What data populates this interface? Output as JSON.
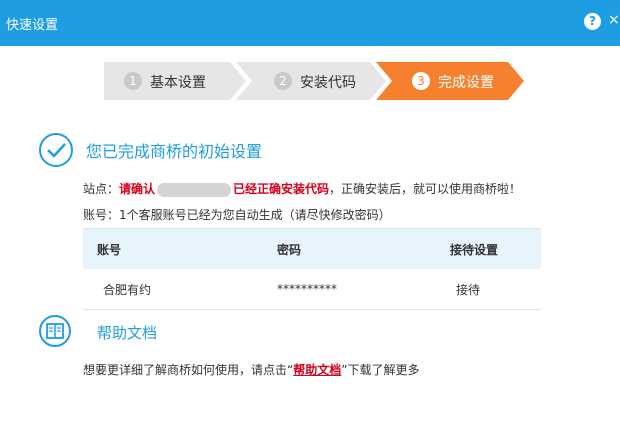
{
  "window": {
    "title": "快速设置",
    "help_symbol": "?",
    "close_symbol": "×"
  },
  "steps": [
    {
      "num": "1",
      "label": "基本设置",
      "state": "done"
    },
    {
      "num": "2",
      "label": "安装代码",
      "state": "done"
    },
    {
      "num": "3",
      "label": "完成设置",
      "state": "active"
    }
  ],
  "colors": {
    "accent": "#1e9de3",
    "active_step": "#f5812e",
    "warning": "#d9001b"
  },
  "completion": {
    "icon": "check-circle-icon",
    "title": "您已完成商桥的初始设置"
  },
  "site_notice": {
    "prefix": "站点：",
    "highlight1": "请确认",
    "highlight2": "已经正确安装代码",
    "suffix": "，正确安装后，就可以使用商桥啦！"
  },
  "account_notice": "账号：1个客服账号已经为您自动生成（请尽快修改密码）",
  "table": {
    "headers": [
      "账号",
      "密码",
      "接待设置"
    ],
    "rows": [
      [
        "合肥有约",
        "**********",
        "接待"
      ]
    ]
  },
  "help": {
    "icon": "document-icon",
    "title": "帮助文档",
    "desc_prefix": "想要更详细了解商桥如何使用，请点击“",
    "link": "帮助文档",
    "desc_suffix": "”下载了解更多"
  }
}
